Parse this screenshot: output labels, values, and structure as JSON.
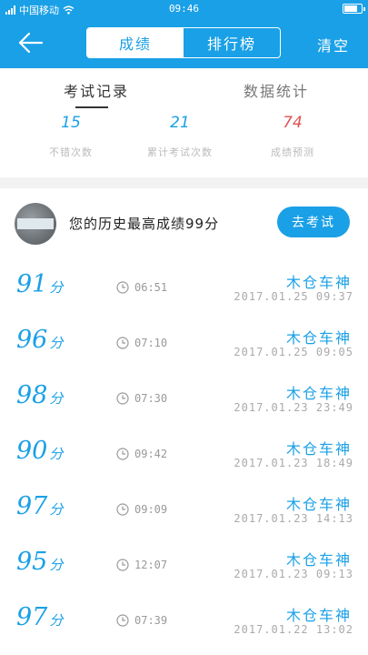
{
  "status_bar": {
    "carrier": "中国移动",
    "time": "09:46",
    "battery_level": 0.8
  },
  "header": {
    "tabs": [
      {
        "label": "成绩",
        "active": true
      },
      {
        "label": "排行榜",
        "active": false
      }
    ],
    "clear_label": "清空",
    "colors": {
      "primary": "#1aa0e6"
    }
  },
  "subtabs": [
    {
      "label": "考试记录",
      "active": true
    },
    {
      "label": "数据统计",
      "active": false
    }
  ],
  "stats": [
    {
      "value": "15",
      "label": "不错次数"
    },
    {
      "value": "21",
      "label": "累计考试次数"
    },
    {
      "value": "74",
      "label": "成绩预测"
    }
  ],
  "best": {
    "text": "您的历史最高成绩99分",
    "button_label": "去考试"
  },
  "records": [
    {
      "score": "91",
      "unit": "分",
      "duration": "06:51",
      "name": "木仓车神",
      "date": "2017.01.25  09:37"
    },
    {
      "score": "96",
      "unit": "分",
      "duration": "07:10",
      "name": "木仓车神",
      "date": "2017.01.25  09:05"
    },
    {
      "score": "98",
      "unit": "分",
      "duration": "07:30",
      "name": "木仓车神",
      "date": "2017.01.23  23:49"
    },
    {
      "score": "90",
      "unit": "分",
      "duration": "09:42",
      "name": "木仓车神",
      "date": "2017.01.23  18:49"
    },
    {
      "score": "97",
      "unit": "分",
      "duration": "09:09",
      "name": "木仓车神",
      "date": "2017.01.23  14:13"
    },
    {
      "score": "95",
      "unit": "分",
      "duration": "12:07",
      "name": "木仓车神",
      "date": "2017.01.23  09:13"
    },
    {
      "score": "97",
      "unit": "分",
      "duration": "07:39",
      "name": "木仓车神",
      "date": "2017.01.22  13:02"
    }
  ]
}
